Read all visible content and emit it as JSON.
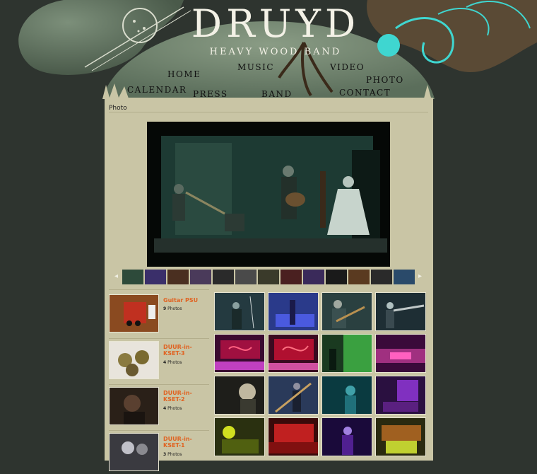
{
  "brand": {
    "logo": "DRUYD",
    "subtitle": "HEAVY WOOD BAND"
  },
  "nav": {
    "home": "HOME",
    "music": "MUSIC",
    "video": "VIDEO",
    "photo": "PHOTO",
    "calendar": "CALENDAR",
    "press": "PRESS",
    "band": "BAND",
    "contact": "CONTACT"
  },
  "page": {
    "breadcrumb": "Photo"
  },
  "filmstrip": {
    "prev_icon": "chevron-left-icon",
    "next_icon": "chevron-right-icon",
    "thumbs": [
      "#2d4a3a",
      "#3a2f6a",
      "#4a2f20",
      "#4a3a5a",
      "#2a2a2a",
      "#4a4a4a",
      "#3a3a2a",
      "#4a2020",
      "#3a2a5a",
      "#1a1a1a",
      "#5a3a20",
      "#2a2a2a",
      "#2a4a6a"
    ]
  },
  "albums": [
    {
      "title": "Guitar PSU",
      "count": "9",
      "unit": "Photos"
    },
    {
      "title": "DUUR-in-KSET-3",
      "count": "4",
      "unit": "Photos"
    },
    {
      "title": "DUUR-in-KSET-2",
      "count": "4",
      "unit": "Photos"
    },
    {
      "title": "DUUR-in-KSET-1",
      "count": "3",
      "unit": "Photos"
    }
  ],
  "colors": {
    "background": "#2e342f",
    "panel": "#c9c5a5",
    "album_title": "#e06322",
    "header_accent": "#3fd6d0"
  }
}
